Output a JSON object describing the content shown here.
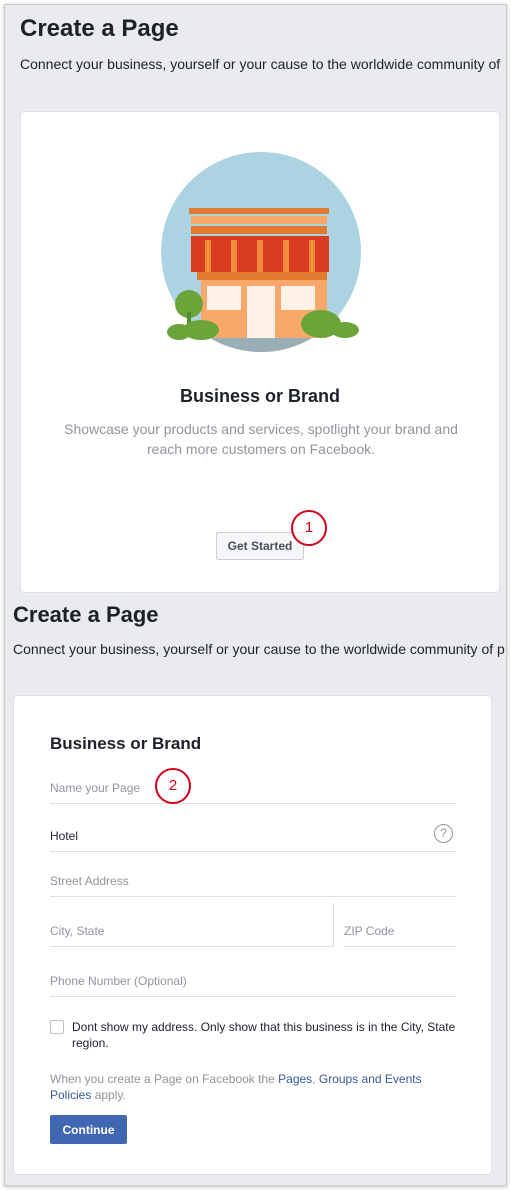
{
  "panel1": {
    "title": "Create a Page",
    "subtitle": "Connect your business, yourself or your cause to the worldwide community of",
    "card": {
      "title": "Business or Brand",
      "description": "Showcase your products and services, spotlight your brand and reach more customers on Facebook.",
      "button": "Get Started",
      "illustration_icon": "storefront-illustration"
    },
    "marker": "1"
  },
  "panel2": {
    "title": "Create a Page",
    "subtitle": "Connect your business, yourself or your cause to the worldwide community of p",
    "form": {
      "title": "Business or Brand",
      "name_placeholder": "Name your Page",
      "category_value": "Hotel",
      "help_icon_glyph": "?",
      "street_placeholder": "Street Address",
      "city_placeholder": "City, State",
      "zip_placeholder": "ZIP Code",
      "phone_placeholder": "Phone Number (Optional)",
      "checkbox_label": "Dont show my address. Only show that this business is in the City, State region.",
      "policy_prefix": "When you create a Page on Facebook the ",
      "policy_link_pages": "Pages",
      "policy_sep": ", ",
      "policy_link_groups": "Groups and Events Policies",
      "policy_suffix": " apply.",
      "continue_button": "Continue"
    },
    "marker": "2"
  },
  "colors": {
    "background": "#e9ebee",
    "card": "#ffffff",
    "primary_button": "#4267b2",
    "link": "#365899",
    "annotation_marker": "#d0021b",
    "muted_text": "#90949c"
  }
}
